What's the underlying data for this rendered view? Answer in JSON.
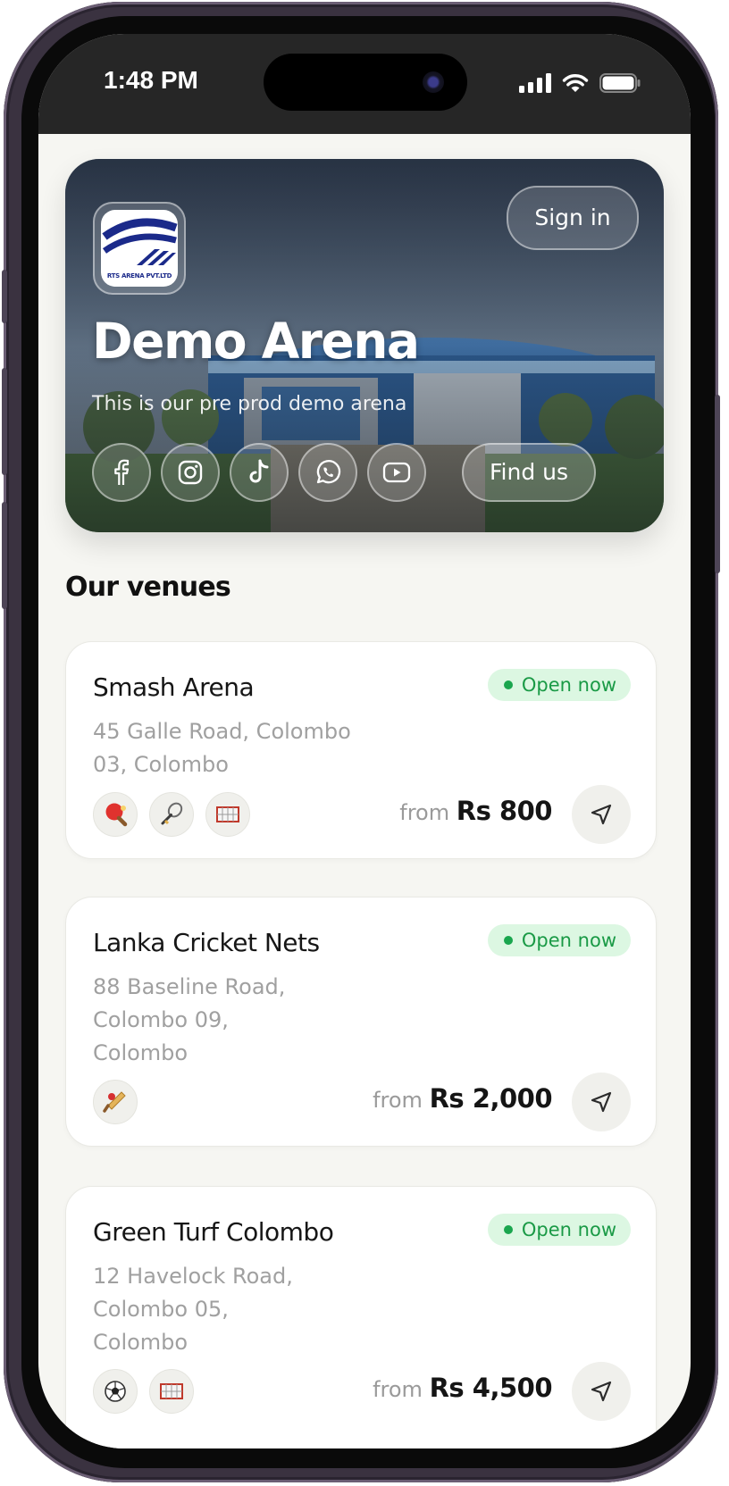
{
  "status_bar": {
    "time": "1:48 PM"
  },
  "hero": {
    "title": "Demo Arena",
    "subtitle": "This is our pre prod demo arena",
    "logo_text": "RTS ARENA PVT.LTD",
    "sign_in_label": "Sign in",
    "find_us_label": "Find us",
    "social_icons": [
      "facebook-icon",
      "instagram-icon",
      "tiktok-icon",
      "whatsapp-icon",
      "youtube-icon"
    ]
  },
  "section": {
    "title": "Our venues"
  },
  "venues": [
    {
      "name": "Smash Arena",
      "status": "Open now",
      "address_lines": [
        "45 Galle Road, Colombo",
        "03, Colombo"
      ],
      "sports": [
        "table-tennis-icon",
        "badminton-icon",
        "futsal-goal-icon"
      ],
      "price_prefix": "from",
      "price": "Rs 800"
    },
    {
      "name": "Lanka Cricket Nets",
      "status": "Open now",
      "address_lines": [
        "88 Baseline Road,",
        "Colombo 09,",
        "Colombo"
      ],
      "sports": [
        "cricket-icon"
      ],
      "price_prefix": "from",
      "price": "Rs 2,000"
    },
    {
      "name": "Green Turf Colombo",
      "status": "Open now",
      "address_lines": [
        "12 Havelock Road,",
        "Colombo 05,",
        "Colombo"
      ],
      "sports": [
        "football-icon",
        "futsal-goal-icon"
      ],
      "price_prefix": "from",
      "price": "Rs 4,500"
    }
  ],
  "colors": {
    "screen_bg": "#f6f6f2",
    "status_bar_bg": "#262626",
    "badge_bg": "#dcf7e2",
    "badge_text": "#1a9a46",
    "address_text": "#a0a0a0"
  }
}
